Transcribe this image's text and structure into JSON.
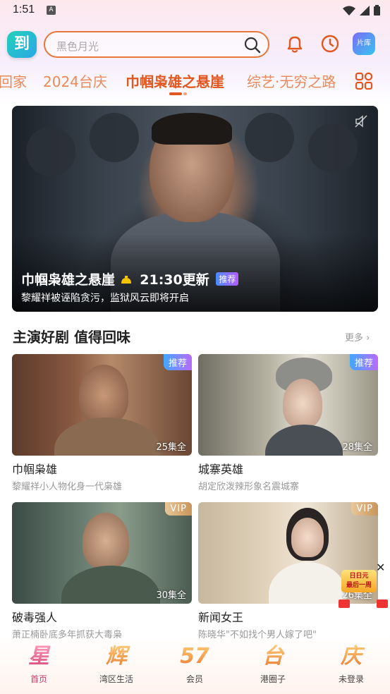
{
  "status_bar": {
    "time": "1:51",
    "notification_glyph": "A"
  },
  "header": {
    "logo_text": "到",
    "search_placeholder": "黑色月光",
    "library_label": "片库"
  },
  "tabs": [
    {
      "label": "回家"
    },
    {
      "label": "2024台庆"
    },
    {
      "label": "巾帼枭雄之悬崖",
      "active": true
    },
    {
      "label": "综艺·无穷之路"
    }
  ],
  "hero": {
    "title": "巾帼枭雄之悬崖",
    "update": "21:30更新",
    "badge": "推荐",
    "subtitle": "黎耀祥被诬陷贪污，监狱风云即将开启"
  },
  "section": {
    "title": "主演好剧 值得回味",
    "more": "更多"
  },
  "cards": [
    {
      "name": "巾帼枭雄",
      "desc": "黎耀祥小人物化身一代枭雄",
      "episodes": "25集全",
      "corner": "推荐",
      "corner_type": "rec"
    },
    {
      "name": "城寨英雄",
      "desc": "胡定欣泼辣形象名震城寨",
      "episodes": "28集全",
      "corner": "推荐",
      "corner_type": "rec"
    },
    {
      "name": "破毒强人",
      "desc": "萧正楠卧底多年抓获大毒枭",
      "episodes": "30集全",
      "corner": "VIP",
      "corner_type": "vip"
    },
    {
      "name": "新闻女王",
      "desc": "陈晓华\"不如找个男人嫁了吧\"",
      "episodes": "26集全",
      "corner": "VIP",
      "corner_type": "vip"
    }
  ],
  "float_ad": {
    "line1": "日日元",
    "line2": "最后一周"
  },
  "bottom_nav": [
    {
      "glyph": "星",
      "label": "首页",
      "active": true
    },
    {
      "glyph": "辉",
      "label": "湾区生活"
    },
    {
      "glyph": "57",
      "label": "会员"
    },
    {
      "glyph": "台",
      "label": "港圈子"
    },
    {
      "glyph": "庆",
      "label": "未登录"
    }
  ],
  "colors": {
    "accent": "#e2561f",
    "tab_inactive": "#e98a5a",
    "vip_gold": "#c9955a",
    "rec_gradient_start": "#40a8ff"
  }
}
